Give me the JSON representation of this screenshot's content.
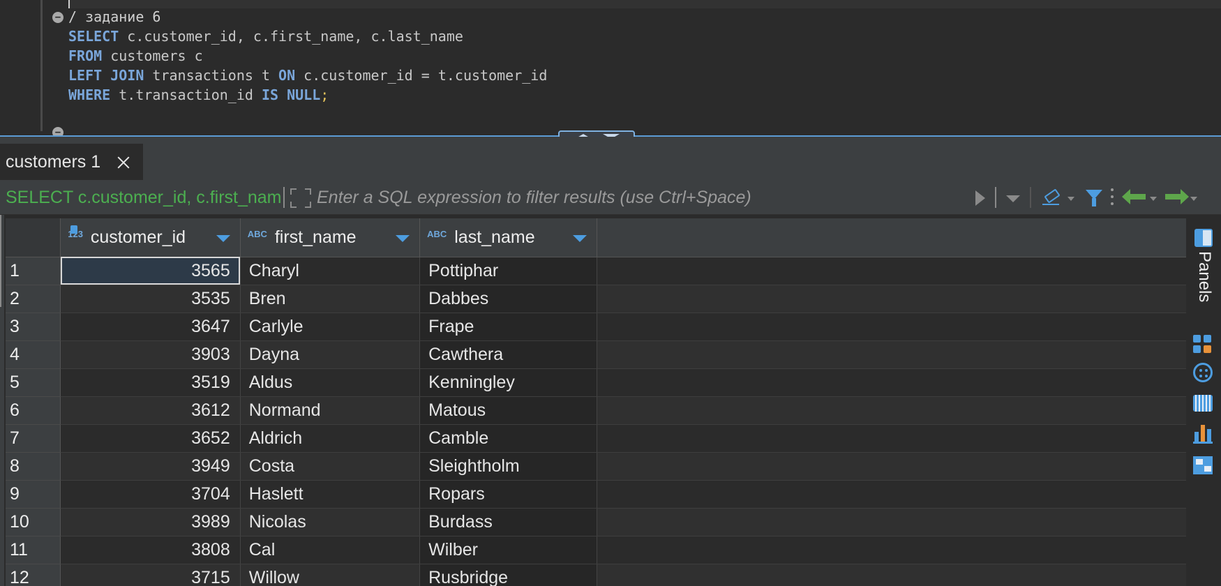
{
  "editor": {
    "comment_line": "/ задание 6",
    "sql": [
      [
        {
          "t": "SELECT",
          "k": true
        },
        {
          "t": " c.customer_id, c.first_name, c.last_name"
        }
      ],
      [
        {
          "t": "FROM",
          "k": true
        },
        {
          "t": " customers c"
        }
      ],
      [
        {
          "t": "LEFT JOIN",
          "k": true
        },
        {
          "t": " transactions t "
        },
        {
          "t": "ON",
          "k": true
        },
        {
          "t": " c.customer_id = t.customer_id"
        }
      ],
      [
        {
          "t": "WHERE",
          "k": true
        },
        {
          "t": " t.transaction_id "
        },
        {
          "t": "IS NULL",
          "k": true
        },
        {
          "t": ";",
          "s": true
        }
      ]
    ]
  },
  "results_tab": {
    "label": "customers 1"
  },
  "filter_bar": {
    "query_snippet": "SELECT c.customer_id, c.first_name, c.last_name",
    "placeholder": "Enter a SQL expression to filter results (use Ctrl+Space)"
  },
  "grid": {
    "columns": [
      {
        "name": "customer_id",
        "type_badge": "123",
        "align": "right"
      },
      {
        "name": "first_name",
        "type_badge": "ABC",
        "align": "left"
      },
      {
        "name": "last_name",
        "type_badge": "ABC",
        "align": "left"
      }
    ],
    "rows": [
      [
        "1",
        "3565",
        "Charyl",
        "Pottiphar"
      ],
      [
        "2",
        "3535",
        "Bren",
        "Dabbes"
      ],
      [
        "3",
        "3647",
        "Carlyle",
        "Frape"
      ],
      [
        "4",
        "3903",
        "Dayna",
        "Cawthera"
      ],
      [
        "5",
        "3519",
        "Aldus",
        "Kenningley"
      ],
      [
        "6",
        "3612",
        "Normand",
        "Matous"
      ],
      [
        "7",
        "3652",
        "Aldrich",
        "Camble"
      ],
      [
        "8",
        "3949",
        "Costa",
        "Sleightholm"
      ],
      [
        "9",
        "3704",
        "Haslett",
        "Ropars"
      ],
      [
        "10",
        "3989",
        "Nicolas",
        "Burdass"
      ],
      [
        "11",
        "3808",
        "Cal",
        "Wilber"
      ],
      [
        "12",
        "3715",
        "Willow",
        "Rusbridge"
      ]
    ],
    "selected_cell": {
      "row": 0,
      "col": 1
    }
  },
  "side_panel": {
    "label": "Panels",
    "icons": [
      "panels-icon",
      "calculator-icon",
      "value-viewer-icon",
      "keyboard-icon",
      "chart-icon",
      "layout-icon"
    ]
  },
  "colors": {
    "keyword": "#7aa6da",
    "filter_query": "#4caf50",
    "accent": "#4d9de0",
    "nav_arrow": "#5ea64b"
  }
}
